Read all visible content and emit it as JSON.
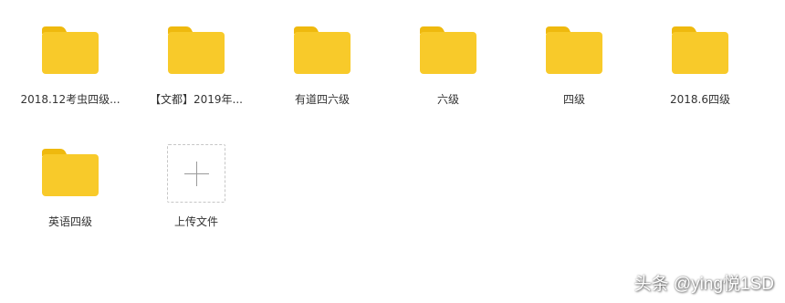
{
  "folders": [
    {
      "name": "2018.12考虫四级..."
    },
    {
      "name": "【文都】2019年..."
    },
    {
      "name": "有道四六级"
    },
    {
      "name": "六级"
    },
    {
      "name": "四级"
    },
    {
      "name": "2018.6四级"
    },
    {
      "name": "英语四级"
    }
  ],
  "upload": {
    "label": "上传文件",
    "icon": "plus-icon"
  },
  "watermark": "头条 @ying悦1SD",
  "colors": {
    "folder_front": "#f8ca2a",
    "folder_back": "#efb90e",
    "label_text": "#333333",
    "upload_border": "#c6c6c6"
  }
}
